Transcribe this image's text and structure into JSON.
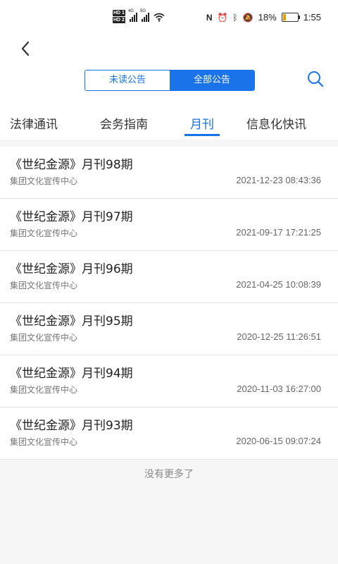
{
  "status": {
    "time": "1:55",
    "battery": "18%",
    "battery_fraction": 0.18,
    "signal_1_label": "4G",
    "signal_2_label": "5G",
    "hd_1": "HD 1",
    "hd_2": "HD 2"
  },
  "header": {
    "back_icon": "chevron-left-icon",
    "segment": {
      "unread": "未读公告",
      "all": "全部公告",
      "active": "all"
    },
    "search_icon": "search-icon"
  },
  "tabs": [
    {
      "label": "法律通讯"
    },
    {
      "label": "会务指南"
    },
    {
      "label": "月刊",
      "active": true
    },
    {
      "label": "信息化快讯"
    }
  ],
  "items": [
    {
      "title": "《世纪金源》月刊98期",
      "source": "集团文化宣传中心",
      "time": "2021-12-23 08:43:36"
    },
    {
      "title": "《世纪金源》月刊97期",
      "source": "集团文化宣传中心",
      "time": "2021-09-17 17:21:25"
    },
    {
      "title": "《世纪金源》月刊96期",
      "source": "集团文化宣传中心",
      "time": "2021-04-25 10:08:39"
    },
    {
      "title": "《世纪金源》月刊95期",
      "source": "集团文化宣传中心",
      "time": "2020-12-25 11:26:51"
    },
    {
      "title": "《世纪金源》月刊94期",
      "source": "集团文化宣传中心",
      "time": "2020-11-03 16:27:00"
    },
    {
      "title": "《世纪金源》月刊93期",
      "source": "集团文化宣传中心",
      "time": "2020-06-15 09:07:24"
    }
  ],
  "footer": {
    "no_more": "没有更多了"
  },
  "colors": {
    "accent": "#1a73e8",
    "battery_low": "#e0a000"
  }
}
